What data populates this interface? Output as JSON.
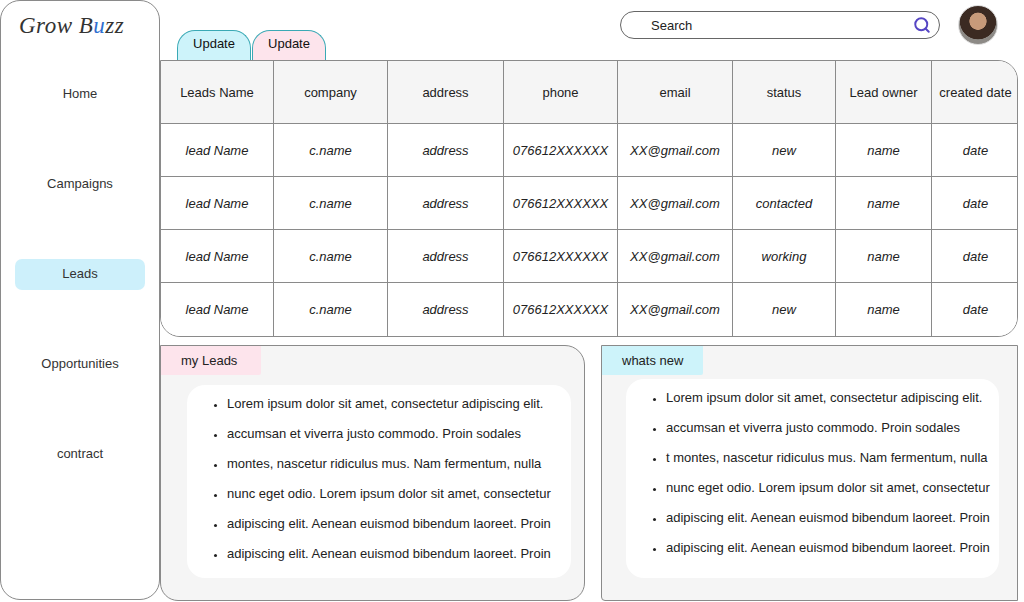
{
  "logo": {
    "parts": [
      {
        "text": "Grow B",
        "color": "#333333"
      },
      {
        "text": "u",
        "color": "#2f6fd0"
      },
      {
        "text": "zz",
        "color": "#333333"
      }
    ]
  },
  "sidebar": {
    "items": [
      {
        "label": "Home",
        "selected": false
      },
      {
        "label": "Campaigns",
        "selected": false
      },
      {
        "label": "Leads",
        "selected": true
      },
      {
        "label": "Opportunities",
        "selected": false
      },
      {
        "label": "contract",
        "selected": false
      }
    ]
  },
  "search": {
    "placeholder": "Search"
  },
  "update_tabs": [
    {
      "label": "Update",
      "color": "#cdf3fa"
    },
    {
      "label": "Update",
      "color": "#fde4ec"
    }
  ],
  "table": {
    "columns": [
      "Leads Name",
      "company",
      "address",
      "phone",
      "email",
      "status",
      "Lead owner",
      "created date"
    ],
    "rows": [
      {
        "cells": [
          "lead Name",
          "c.name",
          "address",
          "076612XXXXXX",
          "XX@gmail.com",
          "new",
          "name",
          "date"
        ]
      },
      {
        "cells": [
          "lead Name",
          "c.name",
          "address",
          "076612XXXXXX",
          "XX@gmail.com",
          "contacted",
          "name",
          "date"
        ]
      },
      {
        "cells": [
          "lead Name",
          "c.name",
          "address",
          "076612XXXXXX",
          "XX@gmail.com",
          "working",
          "name",
          "date"
        ]
      },
      {
        "cells": [
          "lead Name",
          "c.name",
          "address",
          "076612XXXXXX",
          "XX@gmail.com",
          "new",
          "name",
          "date"
        ]
      }
    ]
  },
  "panels": [
    {
      "title": "my Leads",
      "color": "#fde4ec",
      "items": [
        "Lorem ipsum dolor sit amet, consectetur adipiscing elit.",
        "accumsan et viverra justo commodo. Proin sodales",
        "montes, nascetur ridiculus mus. Nam fermentum, nulla",
        "nunc eget odio. Lorem ipsum dolor sit amet, consectetur",
        "adipiscing elit. Aenean euismod bibendum laoreet. Proin",
        "adipiscing elit. Aenean euismod bibendum laoreet. Proin"
      ]
    },
    {
      "title": "whats new",
      "color": "#cdf3fa",
      "items": [
        "Lorem ipsum dolor sit amet, consectetur adipiscing elit.",
        "accumsan et viverra justo commodo. Proin sodales",
        "t montes, nascetur ridiculus mus. Nam fermentum, nulla",
        "nunc eget odio. Lorem ipsum dolor sit amet, consectetur",
        "adipiscing elit. Aenean euismod bibendum laoreet. Proin",
        "adipiscing elit. Aenean euismod bibendum laoreet. Proin"
      ]
    }
  ]
}
